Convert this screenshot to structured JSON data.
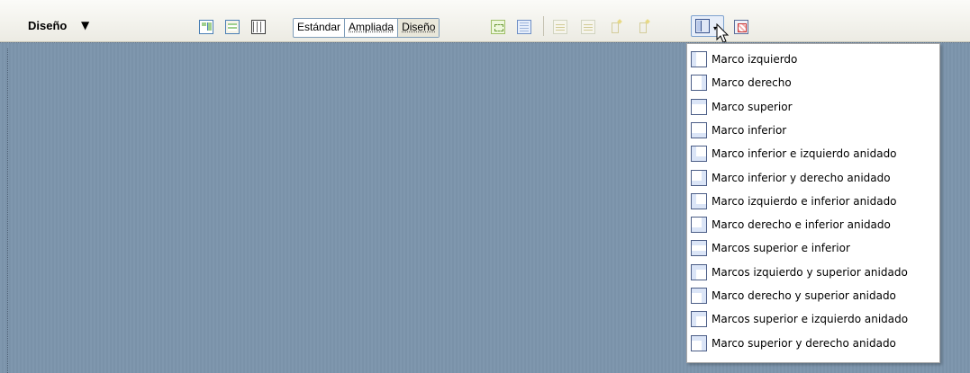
{
  "panel": {
    "title": "Diseño",
    "caret": "▼"
  },
  "toolbar": {
    "view_modes": [
      "Estándar",
      "Ampliada",
      "Diseño"
    ],
    "frames_dropdown_caret": "▾"
  },
  "frames_menu": {
    "items": [
      {
        "label": "Marco izquierdo",
        "icon": "frame-left-icon"
      },
      {
        "label": "Marco derecho",
        "icon": "frame-right-icon"
      },
      {
        "label": "Marco superior",
        "icon": "frame-top-icon"
      },
      {
        "label": "Marco inferior",
        "icon": "frame-bottom-icon"
      },
      {
        "label": "Marco inferior e izquierdo anidado",
        "icon": "frame-bottom-left-nested-icon"
      },
      {
        "label": "Marco inferior y derecho anidado",
        "icon": "frame-bottom-right-nested-icon"
      },
      {
        "label": "Marco izquierdo e inferior anidado",
        "icon": "frame-left-bottom-nested-icon"
      },
      {
        "label": "Marco derecho e inferior anidado",
        "icon": "frame-right-bottom-nested-icon"
      },
      {
        "label": "Marcos superior e inferior",
        "icon": "frame-top-bottom-icon"
      },
      {
        "label": "Marcos izquierdo y superior anidado",
        "icon": "frame-left-top-nested-icon"
      },
      {
        "label": "Marco derecho y superior anidado",
        "icon": "frame-right-top-nested-icon"
      },
      {
        "label": "Marcos superior e izquierdo anidado",
        "icon": "frame-top-left-nested-icon"
      },
      {
        "label": "Marco superior y derecho anidado",
        "icon": "frame-top-right-nested-icon"
      }
    ]
  },
  "colors": {
    "toolbar_bg": "#ecebe3",
    "canvas_bg": "#7f97ae",
    "menu_bg": "#ffffff",
    "frame_icon_fill": "#dbe5f7",
    "frame_icon_border": "#4b5d86"
  }
}
